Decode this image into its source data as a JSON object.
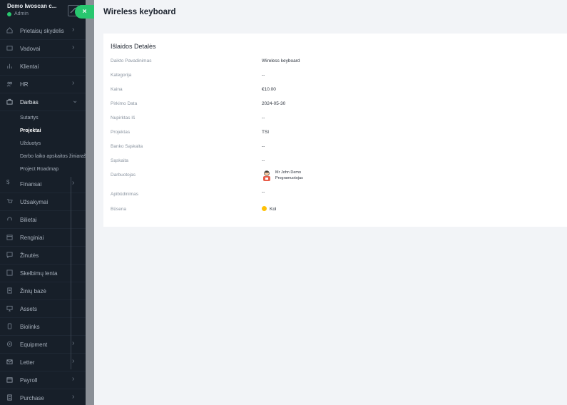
{
  "app": {
    "company": "Demo Iwoscan c...",
    "role": "Admin"
  },
  "sidebar": {
    "items": [
      {
        "label": "Prietaisų skydelis",
        "icon": "dashboard-icon",
        "chevron": true
      },
      {
        "label": "Vadovai",
        "icon": "id-card-icon",
        "chevron": true
      },
      {
        "label": "Klientai",
        "icon": "chart-icon",
        "chevron": false
      },
      {
        "label": "HR",
        "icon": "users-icon",
        "chevron": true
      },
      {
        "label": "Darbas",
        "icon": "briefcase-icon",
        "chevron": true,
        "expanded": true
      }
    ],
    "subitems": [
      "Sutartys",
      "Projektai",
      "Užduotys",
      "Darbo laiko apskaitos žiniaraštis",
      "Project Roadmap"
    ],
    "active_subitem": "Projektai",
    "items_after": [
      {
        "label": "Finansai",
        "icon": "dollar-icon",
        "chevron": true
      },
      {
        "label": "Užsakymai",
        "icon": "cart-icon",
        "chevron": false
      },
      {
        "label": "Bilietai",
        "icon": "headset-icon",
        "chevron": false
      },
      {
        "label": "Renginiai",
        "icon": "calendar-icon",
        "chevron": false
      },
      {
        "label": "Žinutės",
        "icon": "message-icon",
        "chevron": false
      },
      {
        "label": "Skelbimų lenta",
        "icon": "board-icon",
        "chevron": false
      },
      {
        "label": "Žinių bazė",
        "icon": "book-icon",
        "chevron": false
      },
      {
        "label": "Assets",
        "icon": "monitor-icon",
        "chevron": false
      },
      {
        "label": "Biolinks",
        "icon": "phone-icon",
        "chevron": false
      },
      {
        "label": "Equipment",
        "icon": "gear-icon",
        "chevron": true
      },
      {
        "label": "Letter",
        "icon": "envelope-icon",
        "chevron": true
      },
      {
        "label": "Payroll",
        "icon": "wallet-icon",
        "chevron": true
      },
      {
        "label": "Purchase",
        "icon": "receipt-icon",
        "chevron": true
      }
    ]
  },
  "toggle_label": "×",
  "page": {
    "title": "Wireless keyboard"
  },
  "card": {
    "title": "Išlaidos Detalės",
    "rows": [
      {
        "key": "Daikto Pavadinimas",
        "value": "Wireless keyboard"
      },
      {
        "key": "Kategorija",
        "value": "--"
      },
      {
        "key": "Kaina",
        "value": "€10.00"
      },
      {
        "key": "Pirkimo Data",
        "value": "2024-05-30"
      },
      {
        "key": "Nupirktas Iš",
        "value": "--"
      },
      {
        "key": "Projektas",
        "value": "TSI"
      },
      {
        "key": "Banko Sąskaita",
        "value": "--"
      },
      {
        "key": "Sąskaita",
        "value": "--"
      },
      {
        "key": "Darbuotojas",
        "value": ""
      },
      {
        "key": "Apibūdinimas",
        "value": "--"
      },
      {
        "key": "Būsena",
        "value": ""
      }
    ],
    "employee": {
      "name": "Mr John Demo",
      "job": "Programuotojas"
    },
    "status": {
      "label": "Kol",
      "color": "#ffc107"
    }
  }
}
